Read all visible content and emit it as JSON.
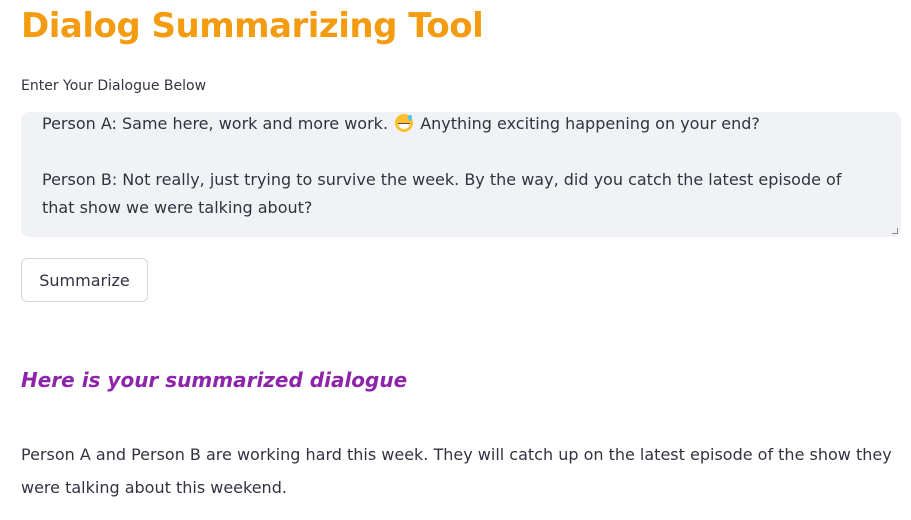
{
  "app": {
    "title": "Dialog Summarizing Tool"
  },
  "input": {
    "label": "Enter Your Dialogue Below",
    "lines": [
      {
        "before_emoji": "Person A: Same here, work and more work.",
        "emoji": "grinning-face-with-sweat-icon",
        "after_emoji": "Anything exciting happening on your end?"
      },
      {
        "text": "Person B: Not really, just trying to survive the week. By the way, did you catch the latest episode of that show we were talking about?"
      }
    ]
  },
  "actions": {
    "summarize_label": "Summarize"
  },
  "result": {
    "heading": "Here is your summarized dialogue",
    "summary": "Person A and Person B are working hard this week. They will catch up on the latest episode of the show they were talking about this weekend."
  },
  "colors": {
    "title": "#f39c12",
    "heading": "#8e24aa",
    "text": "#31333f",
    "input_background": "#f0f2f6"
  }
}
